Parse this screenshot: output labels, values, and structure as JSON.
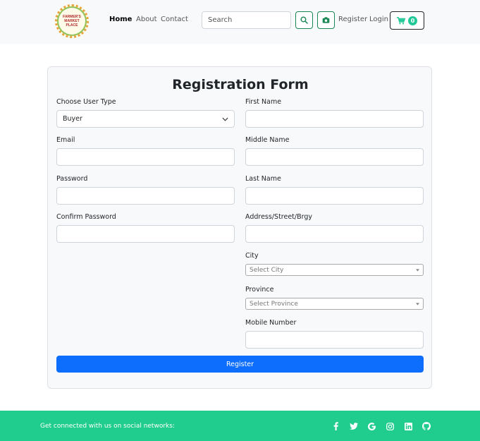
{
  "nav": {
    "logo_text": "FARMER'S MARKET PLACE",
    "links": [
      "Home",
      "About",
      "Contact"
    ],
    "search_placeholder": "Search",
    "register_label": "Register",
    "login_label": "Login",
    "cart_count": "0"
  },
  "form": {
    "title": "Registration Form",
    "user_type_label": "Choose User Type",
    "user_type_value": "Buyer",
    "email_label": "Email",
    "password_label": "Password",
    "confirm_password_label": "Confirm Password",
    "first_name_label": "First Name",
    "middle_name_label": "Middle Name",
    "last_name_label": "Last Name",
    "address_label": "Address/Street/Brgy",
    "city_label": "City",
    "city_placeholder": "Select City",
    "province_label": "Province",
    "province_placeholder": "Select Province",
    "mobile_label": "Mobile Number",
    "submit_label": "Register"
  },
  "footer": {
    "text": "Get connected with us on social networks:",
    "social_icons": [
      "facebook-icon",
      "twitter-icon",
      "google-icon",
      "instagram-icon",
      "linkedin-icon",
      "github-icon"
    ]
  },
  "colors": {
    "primary": "#0d6efd",
    "success": "#198754",
    "footer": "#21cc8f",
    "badge": "#20c997"
  }
}
